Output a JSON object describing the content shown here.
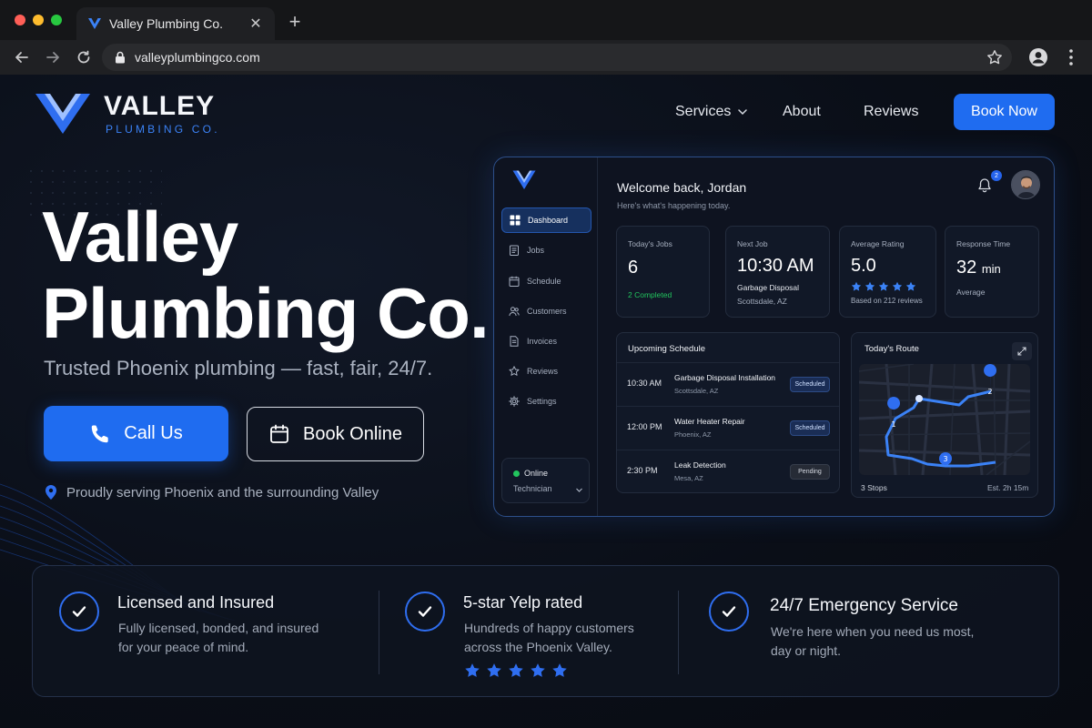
{
  "browser": {
    "tab_title": "Valley Plumbing Co.",
    "url": "valleyplumbingco.com"
  },
  "logo": {
    "word": "VALLEY",
    "sub": "PLUMBING CO."
  },
  "nav": {
    "services": "Services",
    "about": "About",
    "reviews": "Reviews",
    "book_now": "Book Now"
  },
  "hero": {
    "title_line1": "Valley",
    "title_line2": "Plumbing Co.",
    "subtitle": "Trusted Phoenix plumbing — fast, fair, 24/7.",
    "call_label": "Call Us",
    "book_label": "Book Online",
    "serving": "Proudly serving Phoenix and the surrounding Valley"
  },
  "dashboard": {
    "sidebar": [
      {
        "label": "Dashboard",
        "icon": "grid-icon"
      },
      {
        "label": "Jobs",
        "icon": "clipboard-icon"
      },
      {
        "label": "Schedule",
        "icon": "calendar-icon"
      },
      {
        "label": "Customers",
        "icon": "users-icon"
      },
      {
        "label": "Invoices",
        "icon": "document-icon"
      },
      {
        "label": "Reviews",
        "icon": "star-icon"
      },
      {
        "label": "Settings",
        "icon": "gear-icon"
      }
    ],
    "status": {
      "online": "Online",
      "role": "Technician"
    },
    "welcome": "Welcome back, Jordan",
    "welcome_sub": "Here's what's happening today.",
    "notifications": "2",
    "stats": {
      "jobs": {
        "label": "Today's Jobs",
        "value": "6",
        "sub": "2  Completed"
      },
      "next": {
        "label": "Next Job",
        "value": "10:30 AM",
        "sub1": "Garbage Disposal",
        "sub2": "Scottsdale, AZ"
      },
      "rating": {
        "label": "Average Rating",
        "value": "5.0",
        "stars": 5,
        "sub": "Based on 212 reviews"
      },
      "response": {
        "label": "Response Time",
        "value": "32",
        "unit": "min",
        "sub": "Average"
      }
    },
    "schedule": {
      "title": "Upcoming Schedule",
      "rows": [
        {
          "time": "10:30 AM",
          "name": "Garbage Disposal Installation",
          "loc": "Scottsdale, AZ",
          "status": "Scheduled"
        },
        {
          "time": "12:00 PM",
          "name": "Water Heater Repair",
          "loc": "Phoenix, AZ",
          "status": "Scheduled"
        },
        {
          "time": "2:30 PM",
          "name": "Leak Detection",
          "loc": "Mesa, AZ",
          "status": "Pending"
        }
      ]
    },
    "route": {
      "title": "Today's Route",
      "stops": "3 Stops",
      "est": "Est. 2h 15m",
      "pins": [
        "1",
        "2",
        "3"
      ]
    }
  },
  "features": [
    {
      "title": "Licensed and Insured",
      "desc1": "Fully licensed, bonded, and insured",
      "desc2": "for your peace of mind."
    },
    {
      "title": "5-star Yelp rated",
      "desc1": "Hundreds of happy customers",
      "desc2": "across the Phoenix Valley.",
      "stars": 5
    },
    {
      "title": "24/7 Emergency Service",
      "desc1": "We're here when you need us most,",
      "desc2": "day or night."
    }
  ],
  "colors": {
    "accent": "#1f6cf0",
    "background": "#0a0e17",
    "success": "#22c55e"
  }
}
